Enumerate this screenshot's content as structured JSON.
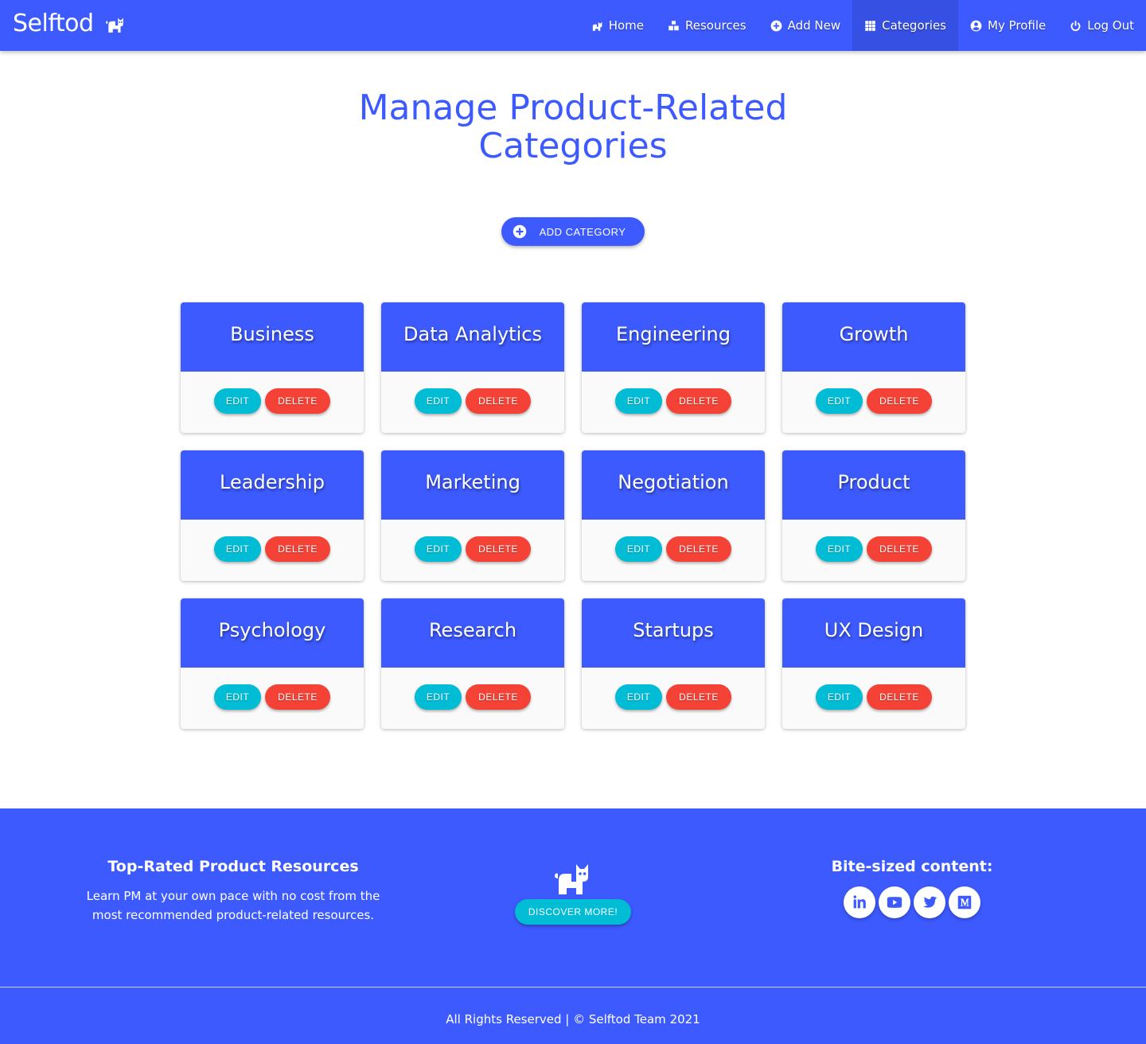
{
  "brand": {
    "name": "Selftod",
    "icon": "cat-icon"
  },
  "nav": {
    "items": [
      {
        "label": "Home",
        "icon": "cat-icon"
      },
      {
        "label": "Resources",
        "icon": "cubes-icon"
      },
      {
        "label": "Add New",
        "icon": "plus-circle-icon"
      },
      {
        "label": "Categories",
        "icon": "grid-icon",
        "active": true
      },
      {
        "label": "My Profile",
        "icon": "user-circle-icon"
      },
      {
        "label": "Log Out",
        "icon": "power-icon"
      }
    ]
  },
  "page": {
    "title_line1": "Manage Product-Related",
    "title_line2": "Categories",
    "add_button": "ADD CATEGORY"
  },
  "categories": [
    {
      "name": "Business",
      "edit": "EDIT",
      "delete": "DELETE"
    },
    {
      "name": "Data Analytics",
      "edit": "EDIT",
      "delete": "DELETE"
    },
    {
      "name": "Engineering",
      "edit": "EDIT",
      "delete": "DELETE"
    },
    {
      "name": "Growth",
      "edit": "EDIT",
      "delete": "DELETE"
    },
    {
      "name": "Leadership",
      "edit": "EDIT",
      "delete": "DELETE"
    },
    {
      "name": "Marketing",
      "edit": "EDIT",
      "delete": "DELETE"
    },
    {
      "name": "Negotiation",
      "edit": "EDIT",
      "delete": "DELETE"
    },
    {
      "name": "Product",
      "edit": "EDIT",
      "delete": "DELETE"
    },
    {
      "name": "Psychology",
      "edit": "EDIT",
      "delete": "DELETE"
    },
    {
      "name": "Research",
      "edit": "EDIT",
      "delete": "DELETE"
    },
    {
      "name": "Startups",
      "edit": "EDIT",
      "delete": "DELETE"
    },
    {
      "name": "UX Design",
      "edit": "EDIT",
      "delete": "DELETE"
    }
  ],
  "footer": {
    "heading": "Top-Rated Product Resources",
    "text": "Learn PM at your own pace with no cost from the most recommended product-related resources.",
    "discover_button": "DISCOVER MORE!",
    "social_heading": "Bite-sized content:",
    "socials": [
      "linkedin-icon",
      "youtube-icon",
      "twitter-icon",
      "medium-icon"
    ],
    "copyright": "All Rights Reserved | © Selftod Team 2021"
  },
  "colors": {
    "primary": "#3d5afe",
    "edit": "#00bcd4",
    "delete": "#f44336"
  }
}
